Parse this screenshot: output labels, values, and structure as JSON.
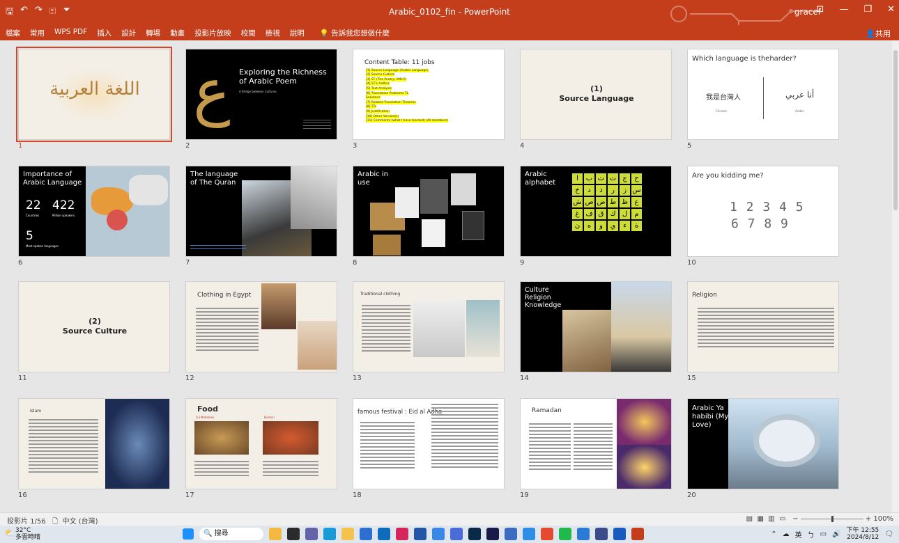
{
  "window": {
    "title": "Arabic_0102_fin - PowerPoint",
    "user": "gracef",
    "share": "共用",
    "qat": [
      "🖫",
      "↶",
      "↷",
      "🗉",
      "⏷"
    ],
    "controls": [
      "⊡",
      "—",
      "❐",
      "✕"
    ]
  },
  "ribbon": {
    "tabs": [
      "檔案",
      "常用",
      "WPS PDF",
      "插入",
      "設計",
      "轉場",
      "動畫",
      "投影片放映",
      "校閱",
      "檢視",
      "說明"
    ],
    "tell_me": "告訴我您想做什麼"
  },
  "slides": [
    {
      "n": "1",
      "calligraphy": "اللغة العربية"
    },
    {
      "n": "2",
      "title": "Exploring the Richness of Arabic Poem",
      "subtitle": "A Bridge between Cultures"
    },
    {
      "n": "3",
      "title": "Content Table: 11 jobs",
      "items": [
        "[1] Source Language (Arabic Language)",
        "[2] Source Culture",
        "[3] ST (The Poetry: 2Min?)",
        "[4] ST's Author",
        "[5] Text Analysis",
        "[6] Translation Problems TL",
        "Solutions",
        "[7] Related Translation Theories",
        "[8] TTs",
        "[9] Justification",
        "[10] Other Version(s)",
        "[11] Comments (what I have learned) (All members)"
      ]
    },
    {
      "n": "4",
      "title": "(1)\nSource Language"
    },
    {
      "n": "5",
      "title": "Which language is theharder?",
      "left": "我是台灣人",
      "right": "أنا عربي",
      "leftcap": "Chinese",
      "rightcap": "Arabic"
    },
    {
      "n": "6",
      "title": "Importance of Arabic Language",
      "stat1": "22",
      "stat1cap": "Countries",
      "stat2": "422",
      "stat2cap": "Million speakers",
      "stat3": "5",
      "stat3cap": "Most spoken languages"
    },
    {
      "n": "7",
      "title": "The language of The Quran"
    },
    {
      "n": "8",
      "title": "Arabic in use"
    },
    {
      "n": "9",
      "title": "Arabic alphabet",
      "letters": [
        "ا",
        "ب",
        "ت",
        "ث",
        "ج",
        "ح",
        "خ",
        "د",
        "ذ",
        "ر",
        "ز",
        "س",
        "ش",
        "ص",
        "ض",
        "ط",
        "ظ",
        "ع",
        "غ",
        "ف",
        "ق",
        "ك",
        "ل",
        "م",
        "ن",
        "ه",
        "و",
        "ي",
        "ء",
        "ة"
      ]
    },
    {
      "n": "10",
      "title": "Are you kidding me?",
      "line1": "1 2 3 4 5",
      "line2": "6 7 8 9"
    },
    {
      "n": "11",
      "title": "(2)\nSource Culture"
    },
    {
      "n": "12",
      "title": "Clothing in Egypt"
    },
    {
      "n": "13",
      "title": "Traditional clothing"
    },
    {
      "n": "14",
      "title": "Culture Religion Knowledge"
    },
    {
      "n": "15",
      "title": "Religion"
    },
    {
      "n": "16",
      "title": "Islam"
    },
    {
      "n": "17",
      "title": "Food",
      "sub1": "Ful Medames",
      "sub2": "Koshari"
    },
    {
      "n": "18",
      "title": "famous festival : Eid al Adha"
    },
    {
      "n": "19",
      "title": "Ramadan"
    },
    {
      "n": "20",
      "title": "Arabic Ya habibi (My Love)"
    }
  ],
  "status": {
    "slide": "投影片 1/56",
    "lang": "中文 (台灣)",
    "zoom": "100%",
    "view_icons": [
      "▤",
      "▦",
      "▥",
      "▭"
    ]
  },
  "taskbar": {
    "temp": "32°C",
    "weather": "多雲時晴",
    "search": "搜尋",
    "ime": "英",
    "time": "下午 12:55",
    "date": "2024/8/12"
  },
  "colors": {
    "accent": "#c43e1c",
    "selection": "#d24726",
    "highlight": "#ffff00",
    "alpha_tile": "#cddc39"
  }
}
